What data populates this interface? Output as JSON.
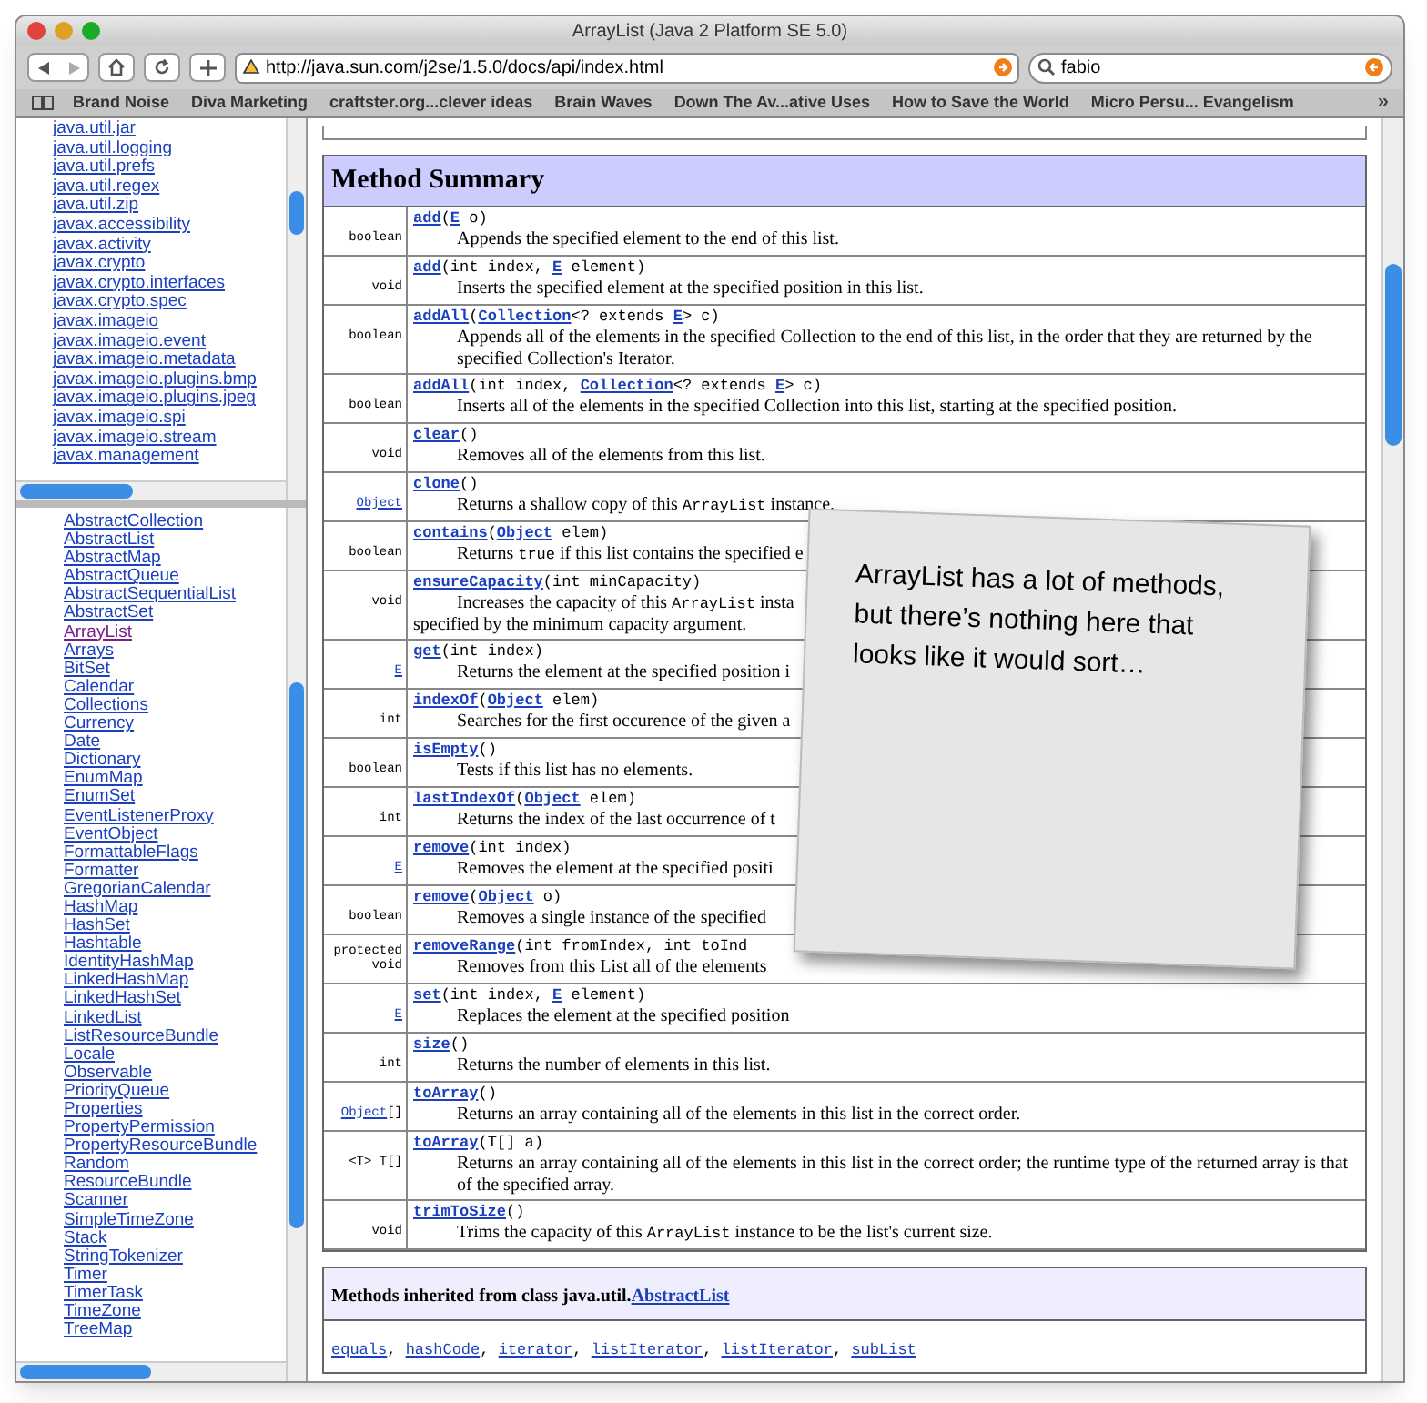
{
  "window": {
    "title": "ArrayList (Java 2 Platform SE 5.0)"
  },
  "toolbar": {
    "url": "http://java.sun.com/j2se/1.5.0/docs/api/index.html",
    "search": {
      "value": "fabio"
    }
  },
  "bookmarks": [
    "Brand Noise",
    "Diva Marketing",
    "craftster.org...clever ideas",
    "Brain Waves",
    "Down The Av...ative Uses",
    "How to Save the World",
    "Micro Persu... Evangelism"
  ],
  "more_bookmarks": "»",
  "packages": [
    "java.util.jar",
    "java.util.logging",
    "java.util.prefs",
    "java.util.regex",
    "java.util.zip",
    "javax.accessibility",
    "javax.activity",
    "javax.crypto",
    "javax.crypto.interfaces",
    "javax.crypto.spec",
    "javax.imageio",
    "javax.imageio.event",
    "javax.imageio.metadata",
    "javax.imageio.plugins.bmp",
    "javax.imageio.plugins.jpeg",
    "javax.imageio.spi",
    "javax.imageio.stream",
    "javax.management"
  ],
  "classes": [
    {
      "label": "AbstractCollection",
      "visited": false
    },
    {
      "label": "AbstractList",
      "visited": false
    },
    {
      "label": "AbstractMap",
      "visited": false
    },
    {
      "label": "AbstractQueue",
      "visited": false
    },
    {
      "label": "AbstractSequentialList",
      "visited": false
    },
    {
      "label": "AbstractSet",
      "visited": false
    },
    {
      "label": "ArrayList",
      "visited": true
    },
    {
      "label": "Arrays",
      "visited": false
    },
    {
      "label": "BitSet",
      "visited": false
    },
    {
      "label": "Calendar",
      "visited": false
    },
    {
      "label": "Collections",
      "visited": false
    },
    {
      "label": "Currency",
      "visited": false
    },
    {
      "label": "Date",
      "visited": false
    },
    {
      "label": "Dictionary",
      "visited": false
    },
    {
      "label": "EnumMap",
      "visited": false
    },
    {
      "label": "EnumSet",
      "visited": false
    },
    {
      "label": "EventListenerProxy",
      "visited": false
    },
    {
      "label": "EventObject",
      "visited": false
    },
    {
      "label": "FormattableFlags",
      "visited": false
    },
    {
      "label": "Formatter",
      "visited": false
    },
    {
      "label": "GregorianCalendar",
      "visited": false
    },
    {
      "label": "HashMap",
      "visited": false
    },
    {
      "label": "HashSet",
      "visited": false
    },
    {
      "label": "Hashtable",
      "visited": false
    },
    {
      "label": "IdentityHashMap",
      "visited": false
    },
    {
      "label": "LinkedHashMap",
      "visited": false
    },
    {
      "label": "LinkedHashSet",
      "visited": false
    },
    {
      "label": "LinkedList",
      "visited": false
    },
    {
      "label": "ListResourceBundle",
      "visited": false
    },
    {
      "label": "Locale",
      "visited": false
    },
    {
      "label": "Observable",
      "visited": false
    },
    {
      "label": "PriorityQueue",
      "visited": false
    },
    {
      "label": "Properties",
      "visited": false
    },
    {
      "label": "PropertyPermission",
      "visited": false
    },
    {
      "label": "PropertyResourceBundle",
      "visited": false
    },
    {
      "label": "Random",
      "visited": false
    },
    {
      "label": "ResourceBundle",
      "visited": false
    },
    {
      "label": "Scanner",
      "visited": false
    },
    {
      "label": "SimpleTimeZone",
      "visited": false
    },
    {
      "label": "Stack",
      "visited": false
    },
    {
      "label": "StringTokenizer",
      "visited": false
    },
    {
      "label": "Timer",
      "visited": false
    },
    {
      "label": "TimerTask",
      "visited": false
    },
    {
      "label": "TimeZone",
      "visited": false
    },
    {
      "label": "TreeMap",
      "visited": false
    }
  ],
  "method_summary": {
    "title": "Method Summary",
    "rows": [
      {
        "type": [
          {
            "text": "boolean"
          }
        ],
        "signature": [
          {
            "text": "add",
            "link": true
          },
          {
            "text": "("
          },
          {
            "text": "E",
            "link": true
          },
          {
            "text": " o)"
          }
        ],
        "description": [
          [
            {
              "text": "Appends the specified element to the end of this list."
            }
          ]
        ]
      },
      {
        "type": [
          {
            "text": "void"
          }
        ],
        "signature": [
          {
            "text": "add",
            "link": true
          },
          {
            "text": "(int index, "
          },
          {
            "text": "E",
            "link": true
          },
          {
            "text": " element)"
          }
        ],
        "description": [
          [
            {
              "text": "Inserts the specified element at the specified position in this list."
            }
          ]
        ]
      },
      {
        "type": [
          {
            "text": "boolean"
          }
        ],
        "signature": [
          {
            "text": "addAll",
            "link": true
          },
          {
            "text": "("
          },
          {
            "text": "Collection",
            "link": true
          },
          {
            "text": "<? extends "
          },
          {
            "text": "E",
            "link": true
          },
          {
            "text": "> c)"
          }
        ],
        "description": [
          [
            {
              "text": "Appends all of the elements in the specified Collection to the end of this list, in the order that they are returned by the specified Collection's Iterator."
            }
          ]
        ]
      },
      {
        "type": [
          {
            "text": "boolean"
          }
        ],
        "signature": [
          {
            "text": "addAll",
            "link": true
          },
          {
            "text": "(int index, "
          },
          {
            "text": "Collection",
            "link": true
          },
          {
            "text": "<? extends "
          },
          {
            "text": "E",
            "link": true
          },
          {
            "text": "> c)"
          }
        ],
        "description": [
          [
            {
              "text": "Inserts all of the elements in the specified Collection into this list, starting at the specified position."
            }
          ]
        ]
      },
      {
        "type": [
          {
            "text": "void"
          }
        ],
        "signature": [
          {
            "text": "clear",
            "link": true
          },
          {
            "text": "()"
          }
        ],
        "description": [
          [
            {
              "text": "Removes all of the elements from this list."
            }
          ]
        ]
      },
      {
        "type": [
          {
            "text": "Object",
            "link": true
          }
        ],
        "signature": [
          {
            "text": "clone",
            "link": true
          },
          {
            "text": "()"
          }
        ],
        "description": [
          [
            {
              "text": "Returns a shallow copy of this "
            },
            {
              "text": "ArrayList",
              "code": true
            },
            {
              "text": " instance."
            }
          ]
        ]
      },
      {
        "type": [
          {
            "text": "boolean"
          }
        ],
        "signature": [
          {
            "text": "contains",
            "link": true
          },
          {
            "text": "("
          },
          {
            "text": "Object",
            "link": true
          },
          {
            "text": " elem)"
          }
        ],
        "description": [
          [
            {
              "text": "Returns "
            },
            {
              "text": "true",
              "code": true
            },
            {
              "text": " if this list contains the specified e"
            }
          ]
        ]
      },
      {
        "type": [
          {
            "text": "void"
          }
        ],
        "signature": [
          {
            "text": "ensureCapacity",
            "link": true
          },
          {
            "text": "(int minCapacity)"
          }
        ],
        "description": [
          [
            {
              "text": "Increases the capacity of this "
            },
            {
              "text": "ArrayList",
              "code": true
            },
            {
              "text": " insta"
            }
          ],
          [
            {
              "text": "specified by the minimum capacity argument."
            }
          ]
        ]
      },
      {
        "type": [
          {
            "text": "E",
            "link": true
          }
        ],
        "signature": [
          {
            "text": "get",
            "link": true
          },
          {
            "text": "(int index)"
          }
        ],
        "description": [
          [
            {
              "text": "Returns the element at the specified position i"
            }
          ]
        ]
      },
      {
        "type": [
          {
            "text": "int"
          }
        ],
        "signature": [
          {
            "text": "indexOf",
            "link": true
          },
          {
            "text": "("
          },
          {
            "text": "Object",
            "link": true
          },
          {
            "text": " elem)"
          }
        ],
        "description": [
          [
            {
              "text": "Searches for the first occurence of the given a"
            }
          ]
        ]
      },
      {
        "type": [
          {
            "text": "boolean"
          }
        ],
        "signature": [
          {
            "text": "isEmpty",
            "link": true
          },
          {
            "text": "()"
          }
        ],
        "description": [
          [
            {
              "text": "Tests if this list has no elements."
            }
          ]
        ]
      },
      {
        "type": [
          {
            "text": "int"
          }
        ],
        "signature": [
          {
            "text": "lastIndexOf",
            "link": true
          },
          {
            "text": "("
          },
          {
            "text": "Object",
            "link": true
          },
          {
            "text": " elem)"
          }
        ],
        "description": [
          [
            {
              "text": "Returns the index of the last occurrence of t"
            }
          ]
        ]
      },
      {
        "type": [
          {
            "text": "E",
            "link": true
          }
        ],
        "signature": [
          {
            "text": "remove",
            "link": true
          },
          {
            "text": "(int index)"
          }
        ],
        "description": [
          [
            {
              "text": "Removes the element at the specified positi"
            }
          ]
        ]
      },
      {
        "type": [
          {
            "text": "boolean"
          }
        ],
        "signature": [
          {
            "text": "remove",
            "link": true
          },
          {
            "text": "("
          },
          {
            "text": "Object",
            "link": true
          },
          {
            "text": " o)"
          }
        ],
        "description": [
          [
            {
              "text": "Removes a single instance of the specified"
            }
          ]
        ]
      },
      {
        "type": [
          {
            "text": "protected void"
          }
        ],
        "signature": [
          {
            "text": "removeRange",
            "link": true
          },
          {
            "text": "(int fromIndex, int toInd"
          }
        ],
        "description": [
          [
            {
              "text": "Removes from this List all of the elements"
            }
          ]
        ]
      },
      {
        "type": [
          {
            "text": "E",
            "link": true
          }
        ],
        "signature": [
          {
            "text": "set",
            "link": true
          },
          {
            "text": "(int index, "
          },
          {
            "text": "E",
            "link": true
          },
          {
            "text": " element)"
          }
        ],
        "description": [
          [
            {
              "text": "Replaces the element at the specified position"
            }
          ]
        ]
      },
      {
        "type": [
          {
            "text": "int"
          }
        ],
        "signature": [
          {
            "text": "size",
            "link": true
          },
          {
            "text": "()"
          }
        ],
        "description": [
          [
            {
              "text": "Returns the number of elements in this list."
            }
          ]
        ]
      },
      {
        "type": [
          {
            "text": "Object",
            "link": true
          },
          {
            "text": "[]"
          }
        ],
        "signature": [
          {
            "text": "toArray",
            "link": true
          },
          {
            "text": "()"
          }
        ],
        "description": [
          [
            {
              "text": "Returns an array containing all of the elements in this list in the correct order."
            }
          ]
        ]
      },
      {
        "type": [
          {
            "text": "<T> T[]"
          }
        ],
        "signature": [
          {
            "text": "toArray",
            "link": true
          },
          {
            "text": "(T[] a)"
          }
        ],
        "description": [
          [
            {
              "text": "Returns an array containing all of the elements in this list in the correct order; the runtime type of the returned array is that of the specified array."
            }
          ]
        ]
      },
      {
        "type": [
          {
            "text": "void"
          }
        ],
        "signature": [
          {
            "text": "trimToSize",
            "link": true
          },
          {
            "text": "()"
          }
        ],
        "description": [
          [
            {
              "text": "Trims the capacity of this "
            },
            {
              "text": "ArrayList",
              "code": true
            },
            {
              "text": " instance to be the list's current size."
            }
          ]
        ]
      }
    ]
  },
  "inherited": {
    "heading": [
      {
        "text": "Methods inherited from class java.util."
      },
      {
        "text": "AbstractList",
        "link": true
      }
    ],
    "methods": [
      {
        "text": "equals",
        "link": true
      },
      {
        "text": ", "
      },
      {
        "text": "hashCode",
        "link": true
      },
      {
        "text": ", "
      },
      {
        "text": "iterator",
        "link": true
      },
      {
        "text": ", "
      },
      {
        "text": "listIterator",
        "link": true
      },
      {
        "text": ", "
      },
      {
        "text": "listIterator",
        "link": true
      },
      {
        "text": ", "
      },
      {
        "text": "subList",
        "link": true
      }
    ]
  },
  "note": {
    "text": "ArrayList has a lot of methods, but there’s nothing here that looks like it would sort…"
  }
}
